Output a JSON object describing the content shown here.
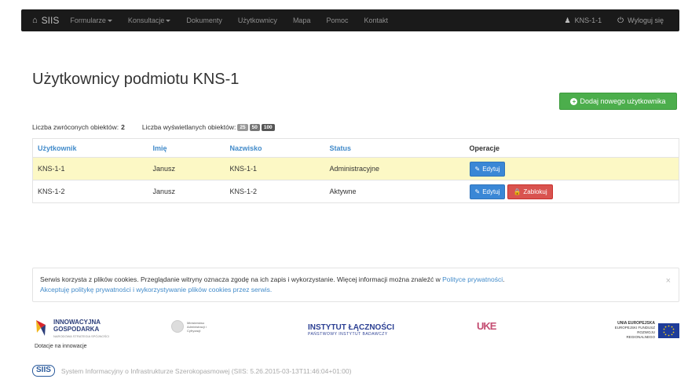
{
  "navbar": {
    "brand": "SIIS",
    "items": [
      {
        "label": "Formularze",
        "dropdown": true
      },
      {
        "label": "Konsultacje",
        "dropdown": true
      },
      {
        "label": "Dokumenty",
        "dropdown": false
      },
      {
        "label": "Użytkownicy",
        "dropdown": false
      },
      {
        "label": "Mapa",
        "dropdown": false
      },
      {
        "label": "Pomoc",
        "dropdown": false
      },
      {
        "label": "Kontakt",
        "dropdown": false
      }
    ],
    "user": "KNS-1-1",
    "logout": "Wyloguj się"
  },
  "page": {
    "title": "Użytkownicy podmiotu KNS-1",
    "add_button": "Dodaj nowego użytkownika"
  },
  "counts": {
    "returned_label": "Liczba zwróconych obiektów:",
    "returned_value": "2",
    "displayed_label": "Liczba wyświetlanych obiektów:",
    "page_sizes": [
      "25",
      "50",
      "100"
    ]
  },
  "table": {
    "headers": [
      "Użytkownik",
      "Imię",
      "Nazwisko",
      "Status",
      "Operacje"
    ],
    "rows": [
      {
        "user": "KNS-1-1",
        "first": "Janusz",
        "last": "KNS-1-1",
        "status": "Administracyjne",
        "actions": [
          "Edytuj"
        ]
      },
      {
        "user": "KNS-1-2",
        "first": "Janusz",
        "last": "KNS-1-2",
        "status": "Aktywne",
        "actions": [
          "Edytuj",
          "Zablokuj"
        ]
      }
    ]
  },
  "cookie": {
    "text": "Serwis korzysta z plików cookies. Przeglądanie witryny oznacza zgodę na ich zapis i wykorzystanie. Więcej informacji można znaleźć w ",
    "policy_link": "Polityce prywatności",
    "text_end": ".",
    "accept_link": "Akceptuję politykę prywatności i wykorzystywanie plików cookies przez serwis.",
    "close": "×"
  },
  "logos": {
    "ig_line1": "INNOWACYJNA",
    "ig_line2": "GOSPODARKA",
    "ig_sub": "NARODOWA STRATEGIA SPÓJNOŚCI",
    "ig_caption": "Dotacje na innowacje",
    "mac_text": "Ministerstwo Administracji i Cyfryzacji",
    "il_main": "INSTYTUT ŁĄCZNOŚCI",
    "il_sub": "PAŃSTWOWY INSTYTUT BADAWCZY",
    "uke": "UKE",
    "ue_title": "UNIA EUROPEJSKA",
    "ue_sub1": "EUROPEJSKI FUNDUSZ",
    "ue_sub2": "ROZWOJU REGIONALNEGO"
  },
  "footer": {
    "logo": "SIIS",
    "text": "System Informacyjny o Infrastrukturze Szerokopasmowej  (SIIS: 5.26.2015-03-13T11:46:04+01:00)"
  },
  "colors": {
    "navbar": "#1a1a1a",
    "accent": "#428bca",
    "success": "#4cae4c",
    "danger": "#d9534f",
    "highlight_row": "#fcf8c5"
  }
}
